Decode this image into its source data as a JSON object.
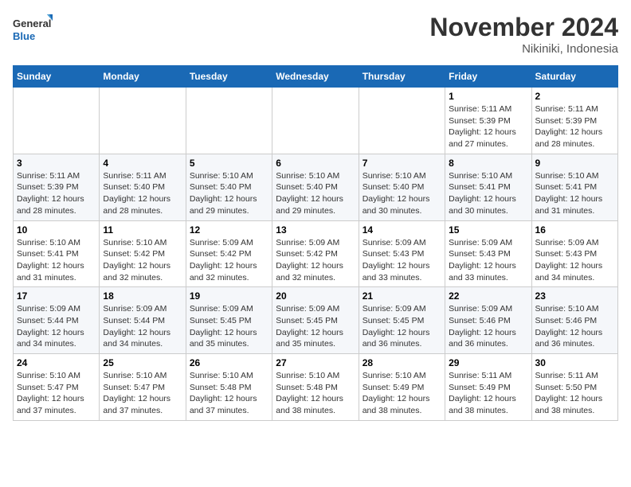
{
  "header": {
    "logo_general": "General",
    "logo_blue": "Blue",
    "month_title": "November 2024",
    "location": "Nikiniki, Indonesia"
  },
  "weekdays": [
    "Sunday",
    "Monday",
    "Tuesday",
    "Wednesday",
    "Thursday",
    "Friday",
    "Saturday"
  ],
  "weeks": [
    [
      {
        "day": "",
        "info": ""
      },
      {
        "day": "",
        "info": ""
      },
      {
        "day": "",
        "info": ""
      },
      {
        "day": "",
        "info": ""
      },
      {
        "day": "",
        "info": ""
      },
      {
        "day": "1",
        "info": "Sunrise: 5:11 AM\nSunset: 5:39 PM\nDaylight: 12 hours\nand 27 minutes."
      },
      {
        "day": "2",
        "info": "Sunrise: 5:11 AM\nSunset: 5:39 PM\nDaylight: 12 hours\nand 28 minutes."
      }
    ],
    [
      {
        "day": "3",
        "info": "Sunrise: 5:11 AM\nSunset: 5:39 PM\nDaylight: 12 hours\nand 28 minutes."
      },
      {
        "day": "4",
        "info": "Sunrise: 5:11 AM\nSunset: 5:40 PM\nDaylight: 12 hours\nand 28 minutes."
      },
      {
        "day": "5",
        "info": "Sunrise: 5:10 AM\nSunset: 5:40 PM\nDaylight: 12 hours\nand 29 minutes."
      },
      {
        "day": "6",
        "info": "Sunrise: 5:10 AM\nSunset: 5:40 PM\nDaylight: 12 hours\nand 29 minutes."
      },
      {
        "day": "7",
        "info": "Sunrise: 5:10 AM\nSunset: 5:40 PM\nDaylight: 12 hours\nand 30 minutes."
      },
      {
        "day": "8",
        "info": "Sunrise: 5:10 AM\nSunset: 5:41 PM\nDaylight: 12 hours\nand 30 minutes."
      },
      {
        "day": "9",
        "info": "Sunrise: 5:10 AM\nSunset: 5:41 PM\nDaylight: 12 hours\nand 31 minutes."
      }
    ],
    [
      {
        "day": "10",
        "info": "Sunrise: 5:10 AM\nSunset: 5:41 PM\nDaylight: 12 hours\nand 31 minutes."
      },
      {
        "day": "11",
        "info": "Sunrise: 5:10 AM\nSunset: 5:42 PM\nDaylight: 12 hours\nand 32 minutes."
      },
      {
        "day": "12",
        "info": "Sunrise: 5:09 AM\nSunset: 5:42 PM\nDaylight: 12 hours\nand 32 minutes."
      },
      {
        "day": "13",
        "info": "Sunrise: 5:09 AM\nSunset: 5:42 PM\nDaylight: 12 hours\nand 32 minutes."
      },
      {
        "day": "14",
        "info": "Sunrise: 5:09 AM\nSunset: 5:43 PM\nDaylight: 12 hours\nand 33 minutes."
      },
      {
        "day": "15",
        "info": "Sunrise: 5:09 AM\nSunset: 5:43 PM\nDaylight: 12 hours\nand 33 minutes."
      },
      {
        "day": "16",
        "info": "Sunrise: 5:09 AM\nSunset: 5:43 PM\nDaylight: 12 hours\nand 34 minutes."
      }
    ],
    [
      {
        "day": "17",
        "info": "Sunrise: 5:09 AM\nSunset: 5:44 PM\nDaylight: 12 hours\nand 34 minutes."
      },
      {
        "day": "18",
        "info": "Sunrise: 5:09 AM\nSunset: 5:44 PM\nDaylight: 12 hours\nand 34 minutes."
      },
      {
        "day": "19",
        "info": "Sunrise: 5:09 AM\nSunset: 5:45 PM\nDaylight: 12 hours\nand 35 minutes."
      },
      {
        "day": "20",
        "info": "Sunrise: 5:09 AM\nSunset: 5:45 PM\nDaylight: 12 hours\nand 35 minutes."
      },
      {
        "day": "21",
        "info": "Sunrise: 5:09 AM\nSunset: 5:45 PM\nDaylight: 12 hours\nand 36 minutes."
      },
      {
        "day": "22",
        "info": "Sunrise: 5:09 AM\nSunset: 5:46 PM\nDaylight: 12 hours\nand 36 minutes."
      },
      {
        "day": "23",
        "info": "Sunrise: 5:10 AM\nSunset: 5:46 PM\nDaylight: 12 hours\nand 36 minutes."
      }
    ],
    [
      {
        "day": "24",
        "info": "Sunrise: 5:10 AM\nSunset: 5:47 PM\nDaylight: 12 hours\nand 37 minutes."
      },
      {
        "day": "25",
        "info": "Sunrise: 5:10 AM\nSunset: 5:47 PM\nDaylight: 12 hours\nand 37 minutes."
      },
      {
        "day": "26",
        "info": "Sunrise: 5:10 AM\nSunset: 5:48 PM\nDaylight: 12 hours\nand 37 minutes."
      },
      {
        "day": "27",
        "info": "Sunrise: 5:10 AM\nSunset: 5:48 PM\nDaylight: 12 hours\nand 38 minutes."
      },
      {
        "day": "28",
        "info": "Sunrise: 5:10 AM\nSunset: 5:49 PM\nDaylight: 12 hours\nand 38 minutes."
      },
      {
        "day": "29",
        "info": "Sunrise: 5:11 AM\nSunset: 5:49 PM\nDaylight: 12 hours\nand 38 minutes."
      },
      {
        "day": "30",
        "info": "Sunrise: 5:11 AM\nSunset: 5:50 PM\nDaylight: 12 hours\nand 38 minutes."
      }
    ]
  ]
}
